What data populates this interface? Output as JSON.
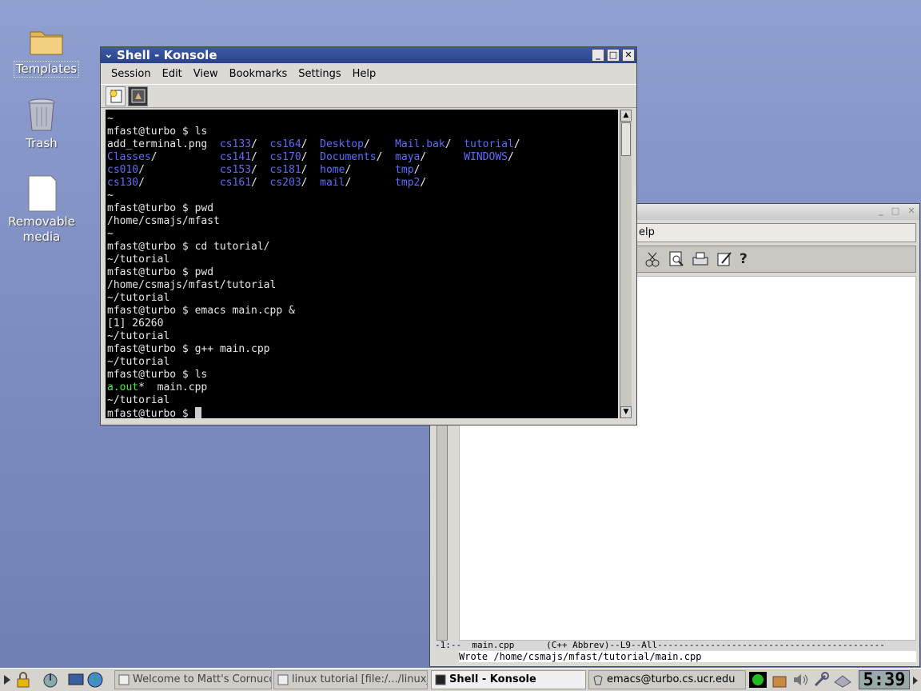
{
  "desktop": {
    "icons": [
      {
        "label": "Templates",
        "icon": "folder-icon"
      },
      {
        "label": "Trash",
        "icon": "trash-icon"
      },
      {
        "label": "Removable",
        "label2": "media",
        "icon": "removable-media-icon"
      }
    ]
  },
  "konsole": {
    "title": "Shell - Konsole",
    "menu": [
      "Session",
      "Edit",
      "View",
      "Bookmarks",
      "Settings",
      "Help"
    ],
    "toolbar": [
      "new-session-icon",
      "konsole-icon"
    ],
    "lines": [
      [
        {
          "t": "~"
        }
      ],
      [
        {
          "t": "mfast@turbo $ ls"
        }
      ],
      [
        {
          "t": "add_terminal.png  "
        },
        {
          "t": "cs133",
          "c": "b"
        },
        {
          "t": "/  "
        },
        {
          "t": "cs164",
          "c": "b"
        },
        {
          "t": "/  "
        },
        {
          "t": "Desktop",
          "c": "b"
        },
        {
          "t": "/    "
        },
        {
          "t": "Mail.bak",
          "c": "b"
        },
        {
          "t": "/  "
        },
        {
          "t": "tutorial",
          "c": "b"
        },
        {
          "t": "/"
        }
      ],
      [
        {
          "t": "Classes",
          "c": "b"
        },
        {
          "t": "/          "
        },
        {
          "t": "cs141",
          "c": "b"
        },
        {
          "t": "/  "
        },
        {
          "t": "cs170",
          "c": "b"
        },
        {
          "t": "/  "
        },
        {
          "t": "Documents",
          "c": "b"
        },
        {
          "t": "/  "
        },
        {
          "t": "maya",
          "c": "b"
        },
        {
          "t": "/      "
        },
        {
          "t": "WINDOWS",
          "c": "b"
        },
        {
          "t": "/"
        }
      ],
      [
        {
          "t": "cs010",
          "c": "b"
        },
        {
          "t": "/            "
        },
        {
          "t": "cs153",
          "c": "b"
        },
        {
          "t": "/  "
        },
        {
          "t": "cs181",
          "c": "b"
        },
        {
          "t": "/  "
        },
        {
          "t": "home",
          "c": "b"
        },
        {
          "t": "/       "
        },
        {
          "t": "tmp",
          "c": "b"
        },
        {
          "t": "/"
        }
      ],
      [
        {
          "t": "cs130",
          "c": "b"
        },
        {
          "t": "/            "
        },
        {
          "t": "cs161",
          "c": "b"
        },
        {
          "t": "/  "
        },
        {
          "t": "cs203",
          "c": "b"
        },
        {
          "t": "/  "
        },
        {
          "t": "mail",
          "c": "b"
        },
        {
          "t": "/       "
        },
        {
          "t": "tmp2",
          "c": "b"
        },
        {
          "t": "/"
        }
      ],
      [
        {
          "t": "~"
        }
      ],
      [
        {
          "t": "mfast@turbo $ pwd"
        }
      ],
      [
        {
          "t": "/home/csmajs/mfast"
        }
      ],
      [
        {
          "t": "~"
        }
      ],
      [
        {
          "t": "mfast@turbo $ cd tutorial/"
        }
      ],
      [
        {
          "t": "~/tutorial"
        }
      ],
      [
        {
          "t": "mfast@turbo $ pwd"
        }
      ],
      [
        {
          "t": "/home/csmajs/mfast/tutorial"
        }
      ],
      [
        {
          "t": "~/tutorial"
        }
      ],
      [
        {
          "t": "mfast@turbo $ emacs main.cpp &"
        }
      ],
      [
        {
          "t": "[1] 26260"
        }
      ],
      [
        {
          "t": "~/tutorial"
        }
      ],
      [
        {
          "t": "mfast@turbo $ g++ main.cpp"
        }
      ],
      [
        {
          "t": "~/tutorial"
        }
      ],
      [
        {
          "t": "mfast@turbo $ ls"
        }
      ],
      [
        {
          "t": "a.out",
          "c": "g"
        },
        {
          "t": "*  main.cpp"
        }
      ],
      [
        {
          "t": "~/tutorial"
        }
      ],
      [
        {
          "t": "mfast@turbo $ "
        }
      ]
    ]
  },
  "emacs": {
    "menu_fragment": "elp",
    "toolbar": [
      "cut-icon",
      "search-icon",
      "print-icon",
      "edit-icon",
      "help-icon"
    ],
    "help_glyph": "?",
    "modeline": "-1:--  main.cpp      (C++ Abbrev)--L9--All-------------------------------------------",
    "modeline_file": "main.cpp",
    "echo": "Wrote /home/csmajs/mfast/tutorial/main.cpp"
  },
  "taskbar": {
    "tasks": [
      {
        "label": "Welcome to Matt's Cornucopia",
        "icon": "browser-icon",
        "active": false
      },
      {
        "label": "linux tutorial [file:/.../linux_tutorial]",
        "icon": "browser-icon",
        "active": false
      },
      {
        "label": "Shell - Konsole",
        "icon": "konsole-icon",
        "active": true
      },
      {
        "label": "emacs@turbo.cs.ucr.edu",
        "icon": "emacs-icon",
        "active": false
      }
    ],
    "clock": "5:39"
  }
}
